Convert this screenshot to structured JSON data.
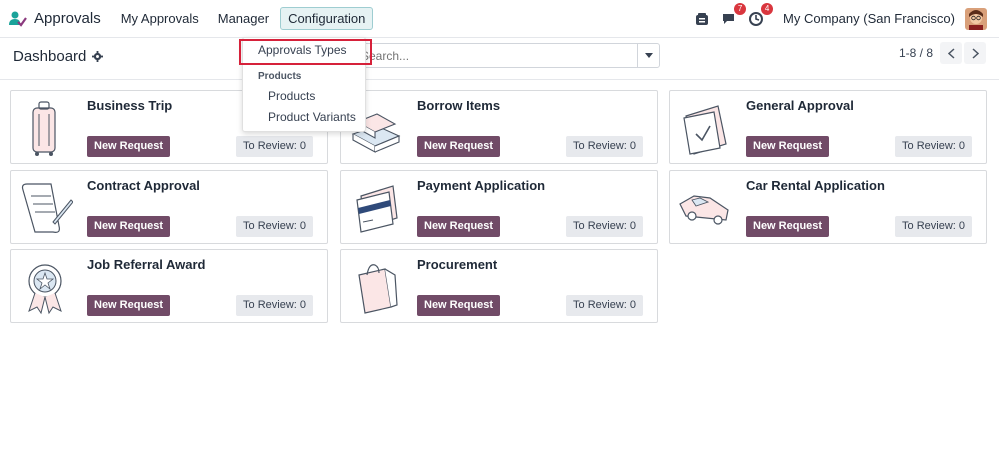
{
  "navbar": {
    "app_title": "Approvals",
    "menu": [
      "My Approvals",
      "Manager",
      "Configuration"
    ],
    "messages_count": "7",
    "activities_count": "4",
    "company": "My Company (San Francisco)"
  },
  "control": {
    "title": "Dashboard",
    "search_placeholder": "Search...",
    "pager": "1-8 / 8"
  },
  "dropdown": {
    "approvals_types": "Approvals Types",
    "products_header": "Products",
    "products": "Products",
    "product_variants": "Product Variants"
  },
  "cards": [
    {
      "title": "Business Trip",
      "new_label": "New Request",
      "review_label": "To Review: 0"
    },
    {
      "title": "Borrow Items",
      "new_label": "New Request",
      "review_label": "To Review: 0"
    },
    {
      "title": "General Approval",
      "new_label": "New Request",
      "review_label": "To Review: 0"
    },
    {
      "title": "Contract Approval",
      "new_label": "New Request",
      "review_label": "To Review: 0"
    },
    {
      "title": "Payment Application",
      "new_label": "New Request",
      "review_label": "To Review: 0"
    },
    {
      "title": "Car Rental Application",
      "new_label": "New Request",
      "review_label": "To Review: 0"
    },
    {
      "title": "Job Referral Award",
      "new_label": "New Request",
      "review_label": "To Review: 0"
    },
    {
      "title": "Procurement",
      "new_label": "New Request",
      "review_label": "To Review: 0"
    }
  ],
  "colors": {
    "primary": "#714b67",
    "accent": "#017e84",
    "badge": "#d9363e",
    "highlight": "#d6213a"
  }
}
